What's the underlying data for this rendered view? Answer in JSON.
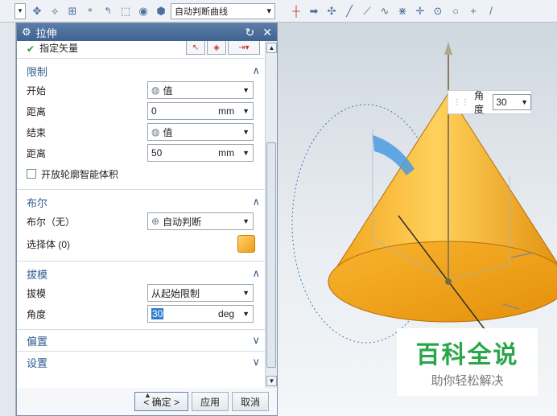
{
  "toolbar": {
    "curve_rule": "自动判断曲线"
  },
  "dialog": {
    "title": "拉伸",
    "vector_label": "指定矢量",
    "sections": {
      "limits": {
        "title": "限制",
        "start_label": "开始",
        "start_value": "值",
        "start_distance_label": "距离",
        "start_distance_value": "0",
        "start_distance_unit": "mm",
        "end_label": "结束",
        "end_value": "值",
        "end_distance_label": "距离",
        "end_distance_value": "50",
        "end_distance_unit": "mm",
        "open_profile_label": "开放轮廓智能体积"
      },
      "boolean": {
        "title": "布尔",
        "boolean_label": "布尔（无）",
        "boolean_value": "自动判断",
        "select_body_label": "选择体 (0)"
      },
      "draft": {
        "title": "拔模",
        "draft_label": "拔模",
        "draft_value": "从起始限制",
        "angle_label": "角度",
        "angle_value": "30",
        "angle_unit": "deg"
      },
      "offset": {
        "title": "偏置"
      },
      "settings": {
        "title": "设置"
      }
    },
    "buttons": {
      "ok": "< 确定 >",
      "apply": "应用",
      "cancel": "取消"
    }
  },
  "viewport": {
    "angle_popup_label": "角度",
    "angle_popup_value": "30"
  },
  "watermark": {
    "main": "百科全说",
    "sub": "助你轻松解决"
  },
  "colors": {
    "dialog_title_bg": "#4a6f9c",
    "section_title": "#2f5c92",
    "cone_orange": "#f5a623",
    "watermark_green": "#2aa64a"
  }
}
